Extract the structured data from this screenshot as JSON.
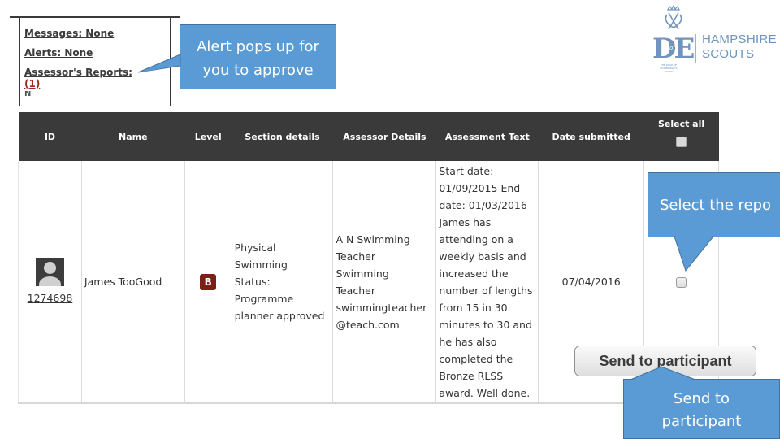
{
  "alerts_panel": {
    "messages": "Messages: None",
    "alerts": "Alerts: None",
    "assessor_reports": "Assessor's Reports:",
    "assessor_reports_count": "(1)"
  },
  "callouts": {
    "alert": "Alert pops up for you to approve",
    "alert_line1": "Alert pops up for",
    "alert_line2": "you to approve",
    "select": "Select the report",
    "select_visible": "Select the repo",
    "send_line1": "Send to",
    "send_line2": "participant"
  },
  "logo": {
    "mark": "DE",
    "mark_of": "of",
    "tagline": "THE DUKE OF EDINBURGH'S AWARD",
    "brand_line1": "HAMPSHIRE",
    "brand_line2": "SCOUTS",
    "color": "#6f94bd"
  },
  "table": {
    "headers": {
      "id": "ID",
      "name": "Name",
      "level": "Level",
      "section": "Section details",
      "assessor": "Assessor Details",
      "text": "Assessment Text",
      "date": "Date submitted",
      "select_all": "Select all"
    },
    "rows": [
      {
        "id": "1274698",
        "name": "James TooGood",
        "level": "B",
        "section": [
          "Physical",
          "Swimming",
          "Status:",
          "Programme",
          "planner approved"
        ],
        "assessor": [
          "A N Swimming",
          "Teacher",
          "Swimming",
          "Teacher",
          "swimmingteacher",
          "@teach.com"
        ],
        "assessment_text": "Start date: 01/09/2015 End date: 01/03/2016 James has attending on a weekly basis and increased the number of lengths from 15 in 30 minutes to 30 and he has also completed the Bronze RLSS award. Well done.",
        "date_submitted": "07/04/2016",
        "selected": false
      }
    ]
  },
  "send_button": {
    "label": "Send to participant"
  },
  "colors": {
    "header_bg": "#3a3a3a",
    "callout_bg": "#5b9bd5",
    "callout_border": "#41719c",
    "level_badge": "#7b2018",
    "count_red": "#9b2a23"
  }
}
